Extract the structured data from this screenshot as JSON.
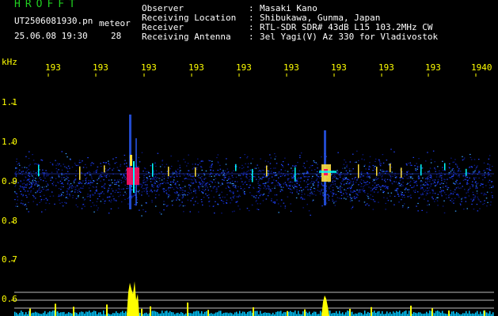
{
  "header": {
    "app_title": "HROFFT",
    "file_name": "UT2506081930.pn",
    "detection_label": "meteor",
    "date_time": "25.06.08 19:30",
    "count": "28"
  },
  "meta": [
    {
      "key": "Observer",
      "value": "Masaki Kano"
    },
    {
      "key": "Receiving Location",
      "value": "Shibukawa, Gunma, Japan"
    },
    {
      "key": "Receiver",
      "value": "RTL-SDR SDR# 43dB L15 103.2MHz CW"
    },
    {
      "key": "Receiving Antenna",
      "value": "3el Yagi(V) Az 330 for Vladivostok"
    }
  ],
  "axis": {
    "y_unit": "kHz",
    "y_ticks": [
      "1.1",
      "1.0",
      "0.9",
      "0.8",
      "0.7",
      "0.6"
    ],
    "x_ticks": [
      "193",
      "193",
      "193",
      "193",
      "193",
      "193",
      "193",
      "193",
      "193",
      "1940"
    ]
  },
  "colors": {
    "background": "#000000",
    "text": "#ffffff",
    "axis": "#ffff00",
    "title": "#20d020",
    "noise_low": "#0a1a8a",
    "noise_mid": "#2244ff",
    "signal_hot": "#ff1060",
    "signal_cyan": "#00ffff",
    "amplitude": "#ffff00",
    "baseline": "#00c8ff"
  }
}
